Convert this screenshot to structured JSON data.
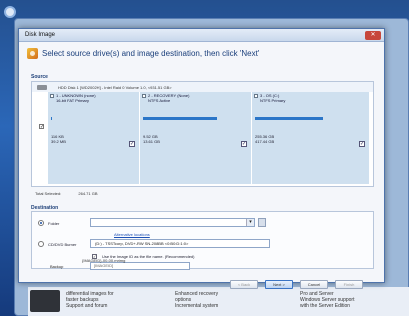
{
  "window": {
    "title": "Disk Image"
  },
  "header": {
    "instruction": "Select source drive(s) and image destination, then click 'Next'"
  },
  "source": {
    "section_label": "Source",
    "disk_line": "HDD Disk 1 [WD2002H] - Intel Raid 0 Volume 1.0, <931.51 GB>",
    "partitions": [
      {
        "label": "1 - UNKNOWN (none)",
        "type": "16-bit FAT Primary",
        "used": "116 KB",
        "total": "39.2 MB",
        "checked": true,
        "fill": 0.01
      },
      {
        "label": "2 - RECOVERY (None)",
        "type": "NTFS Active",
        "used": "9.52 GB",
        "total": "13.61 GB",
        "checked": true,
        "fill": 0.7
      },
      {
        "label": "3 - OS (C:)",
        "type": "NTFS Primary",
        "used": "255.36 GB",
        "total": "417.44 GB",
        "checked": true,
        "fill": 0.61
      }
    ],
    "total_label": "Total Selected:",
    "total_value": "264.71 GB"
  },
  "destination": {
    "section_label": "Destination",
    "folder_label": "Folder",
    "alt_link": "Alternative locations",
    "burner_label": "CD/DVD Burner",
    "burner_value": "(D:) - TSSTcorp, DVD+-RW SN-208BB <0:B0:D:1:0>",
    "unique_cb_label": "Use the Image ID as the file name. (Recommended)",
    "backup_label": "Backup",
    "backup_placeholder": "[IMAGEID]",
    "filename_hint": "{IMAGEID}-00-00.mrimg"
  },
  "buttons": {
    "back": "< Back",
    "next": "Next >",
    "cancel": "Cancel",
    "finish": "Finish"
  },
  "background": {
    "col1": [
      "differential images for",
      "faster backups",
      "Support and forum"
    ],
    "col2": [
      "Enhanced recovery",
      "options",
      "Incremental system"
    ],
    "col3": [
      "Pro and Server",
      "Windows Server support",
      "with the Server Edition"
    ]
  }
}
